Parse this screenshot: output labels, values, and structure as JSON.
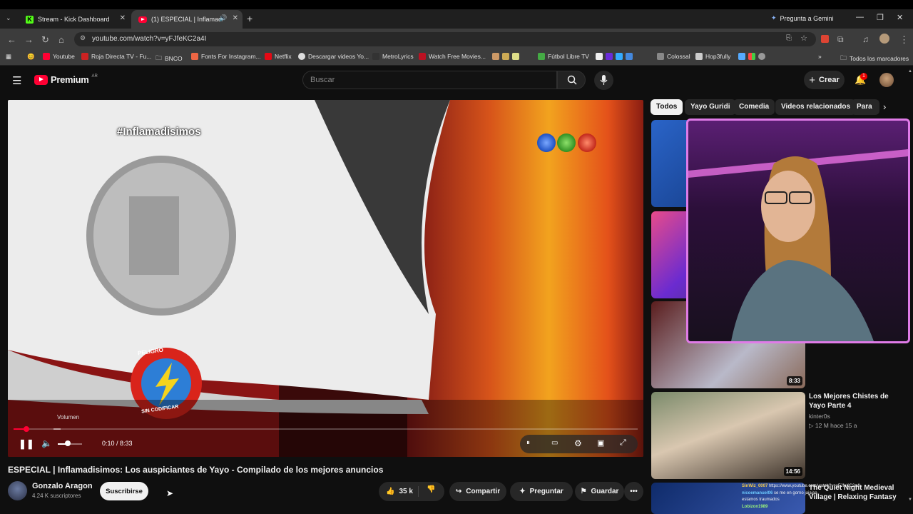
{
  "browser": {
    "tabs": [
      {
        "title": "Stream - Kick Dashboard"
      },
      {
        "title": "(1) ESPECIAL | Inflamadisimos"
      }
    ],
    "gemini_label": "Pregunta a Gemini",
    "url": "youtube.com/watch?v=yFJfeKC2a4I",
    "bookmarks": [
      {
        "label": "Youtube"
      },
      {
        "label": "Roja Directa TV - Fu..."
      },
      {
        "label": "BNCO"
      },
      {
        "label": "Fonts For Instagram..."
      },
      {
        "label": "Netflix"
      },
      {
        "label": "Descargar videos Yo..."
      },
      {
        "label": "MetroLyrics"
      },
      {
        "label": "Watch Free Movies..."
      },
      {
        "label": "Fútbol Libre TV"
      },
      {
        "label": "Colossal"
      },
      {
        "label": "Hop3fully"
      }
    ],
    "all_bookmarks_label": "Todos los marcadores"
  },
  "yt": {
    "logo_text": "Premium",
    "region": "AR",
    "search_placeholder": "Buscar",
    "create_label": "Crear",
    "notif_count": "1"
  },
  "player": {
    "overlay_hashtag": "#Inflamadisimos",
    "badge_top": "PELIGRO",
    "badge_bottom": "SIN CODIFICAR",
    "volume_tooltip": "Volumen",
    "time": "0:10 / 8:33",
    "progress_fraction": 0.02
  },
  "video": {
    "title": "ESPECIAL | Inflamadisimos: Los auspiciantes de Yayo - Compilado de los mejores anuncios",
    "channel": "Gonzalo Aragon",
    "subs": "4.24 K suscriptores",
    "subscribe_label": "Suscribirse",
    "likes": "35 k",
    "share_label": "Compartir",
    "ask_label": "Preguntar",
    "save_label": "Guardar"
  },
  "chips": [
    "Todos",
    "Yayo Guridi",
    "Comedia",
    "Videos relacionados",
    "Para"
  ],
  "sidebar": {
    "items": [
      {
        "duration": "8:33"
      },
      {
        "title": "Los Mejores Chistes de Yayo Parte 4",
        "channel": "kinter0s",
        "meta": "12 M hace 15 a",
        "duration": "14:56"
      },
      {
        "title": "The Quiet Night Medieval Village | Relaxing Fantasy"
      }
    ]
  },
  "chat": {
    "lines": [
      {
        "user": "SinWiz_0007",
        "text": "https://www.youtube.com/watch?v=yFJfeKC2a4I"
      },
      {
        "user": "nicoemanuel06",
        "text": "se me en gorno jajajaa"
      },
      {
        "user": "",
        "text": "estamos traumados"
      },
      {
        "user": "Lobizon1989",
        "text": ""
      }
    ]
  },
  "colors": {
    "yt_red": "#ff0033",
    "kick_green": "#53fc18",
    "cam_border": "#e07be8"
  }
}
